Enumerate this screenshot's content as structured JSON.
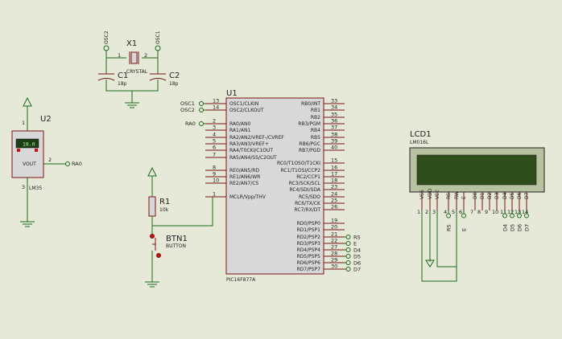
{
  "components": {
    "u1": {
      "ref": "U1",
      "part": "PIC16F877A",
      "left_pins": [
        {
          "num": "13",
          "name": "OSC1/CLKIN"
        },
        {
          "num": "14",
          "name": "OSC2/CLKOUT"
        },
        {
          "num": "2",
          "name": "RA0/AN0"
        },
        {
          "num": "3",
          "name": "RA1/AN1"
        },
        {
          "num": "4",
          "name": "RA2/AN2/VREF-/CVREF"
        },
        {
          "num": "5",
          "name": "RA3/AN3/VREF+"
        },
        {
          "num": "6",
          "name": "RA4/T0CKI/C1OUT"
        },
        {
          "num": "7",
          "name": "RA5/AN4/SS/C2OUT"
        },
        {
          "num": "8",
          "name": "RE0/AN5/RD"
        },
        {
          "num": "9",
          "name": "RE1/AN6/WR"
        },
        {
          "num": "10",
          "name": "RE2/AN7/CS"
        },
        {
          "num": "1",
          "name": "MCLR/Vpp/THV"
        }
      ],
      "right_pins": [
        {
          "num": "33",
          "name": "RB0/INT"
        },
        {
          "num": "34",
          "name": "RB1"
        },
        {
          "num": "35",
          "name": "RB2"
        },
        {
          "num": "36",
          "name": "RB3/PGM"
        },
        {
          "num": "37",
          "name": "RB4"
        },
        {
          "num": "38",
          "name": "RB5"
        },
        {
          "num": "39",
          "name": "RB6/PGC"
        },
        {
          "num": "40",
          "name": "RB7/PGD"
        },
        {
          "num": "15",
          "name": "RC0/T1OSO/T1CKI"
        },
        {
          "num": "16",
          "name": "RC1/T1OSI/CCP2"
        },
        {
          "num": "17",
          "name": "RC2/CCP1"
        },
        {
          "num": "18",
          "name": "RC3/SCK/SCL"
        },
        {
          "num": "23",
          "name": "RC4/SDI/SDA"
        },
        {
          "num": "24",
          "name": "RC5/SDO"
        },
        {
          "num": "25",
          "name": "RC6/TX/CK"
        },
        {
          "num": "26",
          "name": "RC7/RX/DT"
        },
        {
          "num": "19",
          "name": "RD0/PSP0"
        },
        {
          "num": "20",
          "name": "RD1/PSP1"
        },
        {
          "num": "21",
          "name": "RD2/PSP2"
        },
        {
          "num": "22",
          "name": "RD3/PSP3"
        },
        {
          "num": "27",
          "name": "RD4/PSP4"
        },
        {
          "num": "28",
          "name": "RD5/PSP5"
        },
        {
          "num": "29",
          "name": "RD6/PSP6"
        },
        {
          "num": "30",
          "name": "RD7/PSP7"
        }
      ],
      "left_nets": {
        "osc1": "OSC1",
        "osc2": "OSC2",
        "ra0": "RA0"
      },
      "rd_nets": [
        "RS",
        "E",
        "D4",
        "D5",
        "D6",
        "D7"
      ]
    },
    "x1": {
      "ref": "X1",
      "value": "CRYSTAL",
      "pin1": "1",
      "pin2": "2",
      "net1": "OSC2",
      "net2": "OSC1"
    },
    "c1": {
      "ref": "C1",
      "value": "18p"
    },
    "c2": {
      "ref": "C2",
      "value": "18p"
    },
    "u2": {
      "ref": "U2",
      "part": "LM35",
      "reading": "18.0",
      "pin_label": "VOUT",
      "pin1": "1",
      "pin2": "2",
      "pin3": "3",
      "net": "RA0"
    },
    "r1": {
      "ref": "R1",
      "value": "10k"
    },
    "btn1": {
      "ref": "BTN1",
      "value": "BUTTON"
    },
    "lcd1": {
      "ref": "LCD1",
      "part": "LM016L",
      "pins": [
        {
          "name": "VSS",
          "num": "1",
          "net": ""
        },
        {
          "name": "VDD",
          "num": "2",
          "net": ""
        },
        {
          "name": "VEE",
          "num": "3",
          "net": ""
        },
        {
          "name": "RS",
          "num": "4",
          "net": "RS"
        },
        {
          "name": "RW",
          "num": "5",
          "net": ""
        },
        {
          "name": "E",
          "num": "6",
          "net": "E"
        },
        {
          "name": "D0",
          "num": "7",
          "net": ""
        },
        {
          "name": "D1",
          "num": "8",
          "net": ""
        },
        {
          "name": "D2",
          "num": "9",
          "net": ""
        },
        {
          "name": "D3",
          "num": "10",
          "net": ""
        },
        {
          "name": "D4",
          "num": "11",
          "net": "D4"
        },
        {
          "name": "D5",
          "num": "12",
          "net": "D5"
        },
        {
          "name": "D6",
          "num": "13",
          "net": "D6"
        },
        {
          "name": "D7",
          "num": "14",
          "net": "D7"
        }
      ]
    }
  },
  "colors": {
    "background": "#e6e8d8",
    "wire": "#1a6b1a",
    "body_outline": "#7a1414",
    "lcd_screen": "#2f4d1c",
    "lcd_display": "#1f8f3f"
  }
}
